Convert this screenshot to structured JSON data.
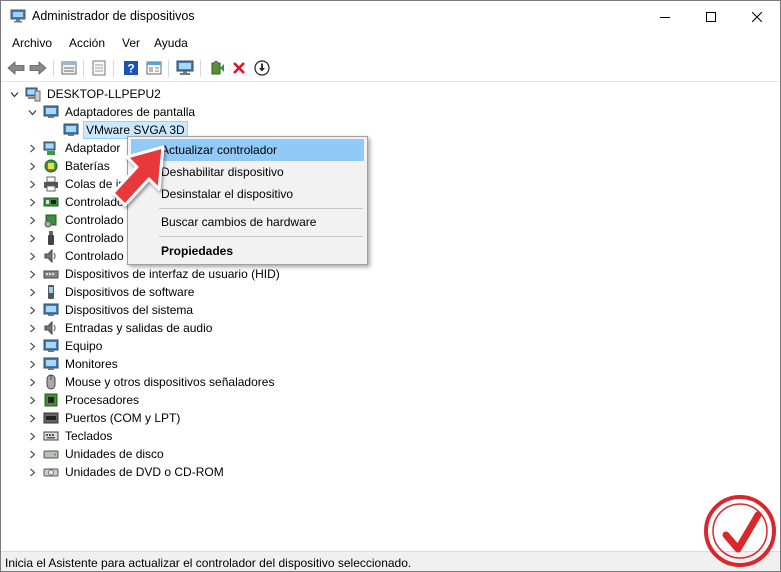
{
  "window": {
    "title": "Administrador de dispositivos",
    "controls": {
      "minimize": "minimize-icon",
      "maximize": "maximize-icon",
      "close": "close-icon"
    }
  },
  "menubar": {
    "items": [
      "Archivo",
      "Acción",
      "Ver",
      "Ayuda"
    ]
  },
  "toolbar": {
    "icons": [
      "back-arrow-icon",
      "forward-arrow-icon",
      "properties-icon",
      "show-hidden-icon",
      "help-icon",
      "view-icon",
      "scan-hardware-icon",
      "update-driver-icon",
      "uninstall-icon",
      "download-icon"
    ],
    "colors": {
      "uninstall": "#e81123",
      "help": "#1c52b8",
      "arrow": "#7a7a7a"
    }
  },
  "tree": {
    "root": "DESKTOP-LLPEPU2",
    "expanded_category": "Adaptadores de pantalla",
    "selected_device": "VMware SVGA 3D",
    "categories": [
      "Adaptadores de pantalla",
      "Adaptadores de red",
      "Baterías",
      "Colas de impresión",
      "Controladoras ATA/ATAPI IDE",
      "Controladoras de almacenamiento",
      "Controladoras de bus serie universal",
      "Controladoras de sonido y vídeo y dispositivos de juego",
      "Dispositivos de interfaz de usuario (HID)",
      "Dispositivos de software",
      "Dispositivos del sistema",
      "Entradas y salidas de audio",
      "Equipo",
      "Monitores",
      "Mouse y otros dispositivos señaladores",
      "Procesadores",
      "Puertos (COM y LPT)",
      "Teclados",
      "Unidades de disco",
      "Unidades de DVD o CD-ROM"
    ],
    "partial_labels": [
      "Adaptador",
      "Baterías",
      "Colas de im",
      "Controlado",
      "Controlado",
      "Controlado",
      "Controlado"
    ]
  },
  "context_menu": {
    "items": [
      {
        "label": "Actualizar controlador",
        "state": "hover"
      },
      {
        "label": "Deshabilitar dispositivo"
      },
      {
        "label": "Desinstalar el dispositivo"
      },
      {
        "label": "Buscar cambios de hardware"
      },
      {
        "label": "Propiedades",
        "bold": true
      }
    ],
    "hover_color": "#91c9f7"
  },
  "statusbar": {
    "text": "Inicia el Asistente para actualizar el controlador del dispositivo seleccionado."
  },
  "colors": {
    "selection_bg": "#cce8ff",
    "arrow_red": "#e8393b",
    "watermark_red": "#d8272d"
  }
}
